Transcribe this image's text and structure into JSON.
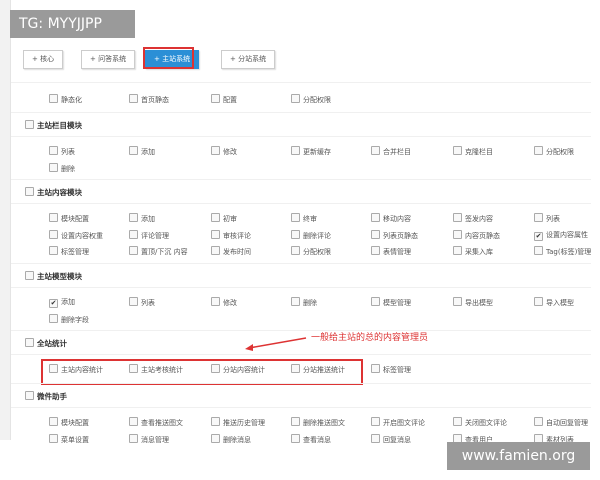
{
  "watermark_top": "TG: MYYJJPP",
  "watermark_bottom": "www.famien.org",
  "tabs": [
    {
      "label": "核心",
      "active": false
    },
    {
      "label": "问答系统",
      "active": false
    },
    {
      "label": "主站系统",
      "active": true
    },
    {
      "label": "分站系统",
      "active": false
    }
  ],
  "top_items": [
    {
      "label": "静态化",
      "checked": false
    },
    {
      "label": "首页静态",
      "checked": false
    },
    {
      "label": "配置",
      "checked": false
    },
    {
      "label": "分配权限",
      "checked": false
    }
  ],
  "sections": [
    {
      "title": "主站栏目模块",
      "items": [
        {
          "label": "列表",
          "checked": false
        },
        {
          "label": "添加",
          "checked": false
        },
        {
          "label": "修改",
          "checked": false
        },
        {
          "label": "更新缓存",
          "checked": false
        },
        {
          "label": "合并栏目",
          "checked": false
        },
        {
          "label": "克隆栏目",
          "checked": false
        },
        {
          "label": "分配权限",
          "checked": false
        },
        {
          "label": "删除",
          "checked": false
        }
      ]
    },
    {
      "title": "主站内容模块",
      "items": [
        {
          "label": "模块配置",
          "checked": false
        },
        {
          "label": "添加",
          "checked": false
        },
        {
          "label": "初审",
          "checked": false
        },
        {
          "label": "终审",
          "checked": false
        },
        {
          "label": "移动内容",
          "checked": false
        },
        {
          "label": "签发内容",
          "checked": false
        },
        {
          "label": "列表",
          "checked": false
        },
        {
          "label": "设置内容权重",
          "checked": false
        },
        {
          "label": "评论管理",
          "checked": false
        },
        {
          "label": "审核评论",
          "checked": false
        },
        {
          "label": "删除评论",
          "checked": false
        },
        {
          "label": "列表页静态",
          "checked": false
        },
        {
          "label": "内容页静态",
          "checked": false
        },
        {
          "label": "设置内容属性",
          "checked": true
        },
        {
          "label": "标签管理",
          "checked": false
        },
        {
          "label": "置顶/下沉 内容",
          "checked": false
        },
        {
          "label": "发布时间",
          "checked": false
        },
        {
          "label": "分配权限",
          "checked": false
        },
        {
          "label": "表情管理",
          "checked": false
        },
        {
          "label": "采集入库",
          "checked": false
        },
        {
          "label": "Tag(标签)管理",
          "checked": false
        }
      ]
    },
    {
      "title": "主站模型模块",
      "items": [
        {
          "label": "添加",
          "checked": true
        },
        {
          "label": "列表",
          "checked": false
        },
        {
          "label": "修改",
          "checked": false
        },
        {
          "label": "删除",
          "checked": false
        },
        {
          "label": "模型管理",
          "checked": false
        },
        {
          "label": "导出模型",
          "checked": false
        },
        {
          "label": "导入模型",
          "checked": false
        },
        {
          "label": "删除字段",
          "checked": false
        }
      ]
    },
    {
      "title": "全站统计",
      "items": [
        {
          "label": "主站内容统计",
          "checked": false
        },
        {
          "label": "主站考核统计",
          "checked": false
        },
        {
          "label": "分站内容统计",
          "checked": false
        },
        {
          "label": "分站推送统计",
          "checked": false
        },
        {
          "label": "标签管理",
          "checked": false
        }
      ]
    },
    {
      "title": "微件助手",
      "items": [
        {
          "label": "模块配置",
          "checked": false
        },
        {
          "label": "查看推送图文",
          "checked": false
        },
        {
          "label": "推送历史管理",
          "checked": false
        },
        {
          "label": "删除推送图文",
          "checked": false
        },
        {
          "label": "开启图文评论",
          "checked": false
        },
        {
          "label": "关闭图文评论",
          "checked": false
        },
        {
          "label": "自动回复管理",
          "checked": false
        },
        {
          "label": "菜单设置",
          "checked": false
        },
        {
          "label": "消息管理",
          "checked": false
        },
        {
          "label": "删除消息",
          "checked": false
        },
        {
          "label": "查看消息",
          "checked": false
        },
        {
          "label": "回复消息",
          "checked": false
        },
        {
          "label": "查看用户",
          "checked": false
        },
        {
          "label": "素材列表",
          "checked": false
        }
      ]
    }
  ],
  "annotation": "一般给主站的总的内容管理员",
  "colors": {
    "accent": "#2b8fd6",
    "highlight": "#dd3333"
  }
}
